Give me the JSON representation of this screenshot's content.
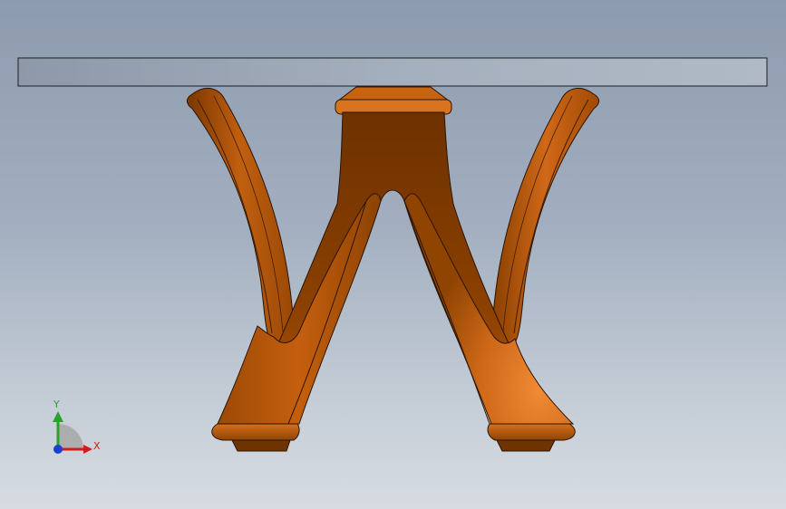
{
  "viewport": {
    "name": "graphics-area",
    "model": "w-shaped-table-leg-assembly"
  },
  "colors": {
    "background_top": "#8d9bae",
    "background_bottom": "#d7dce2",
    "tabletop": "#9aa6b5",
    "part_dark": "#6e3100",
    "part_mid": "#b65407",
    "part_light": "#e57e2c",
    "axis_x": "#d21b1b",
    "axis_y": "#2aa32a",
    "axis_z": "#1b3fcf"
  },
  "triad": {
    "x_label": "X",
    "y_label": "Y"
  }
}
